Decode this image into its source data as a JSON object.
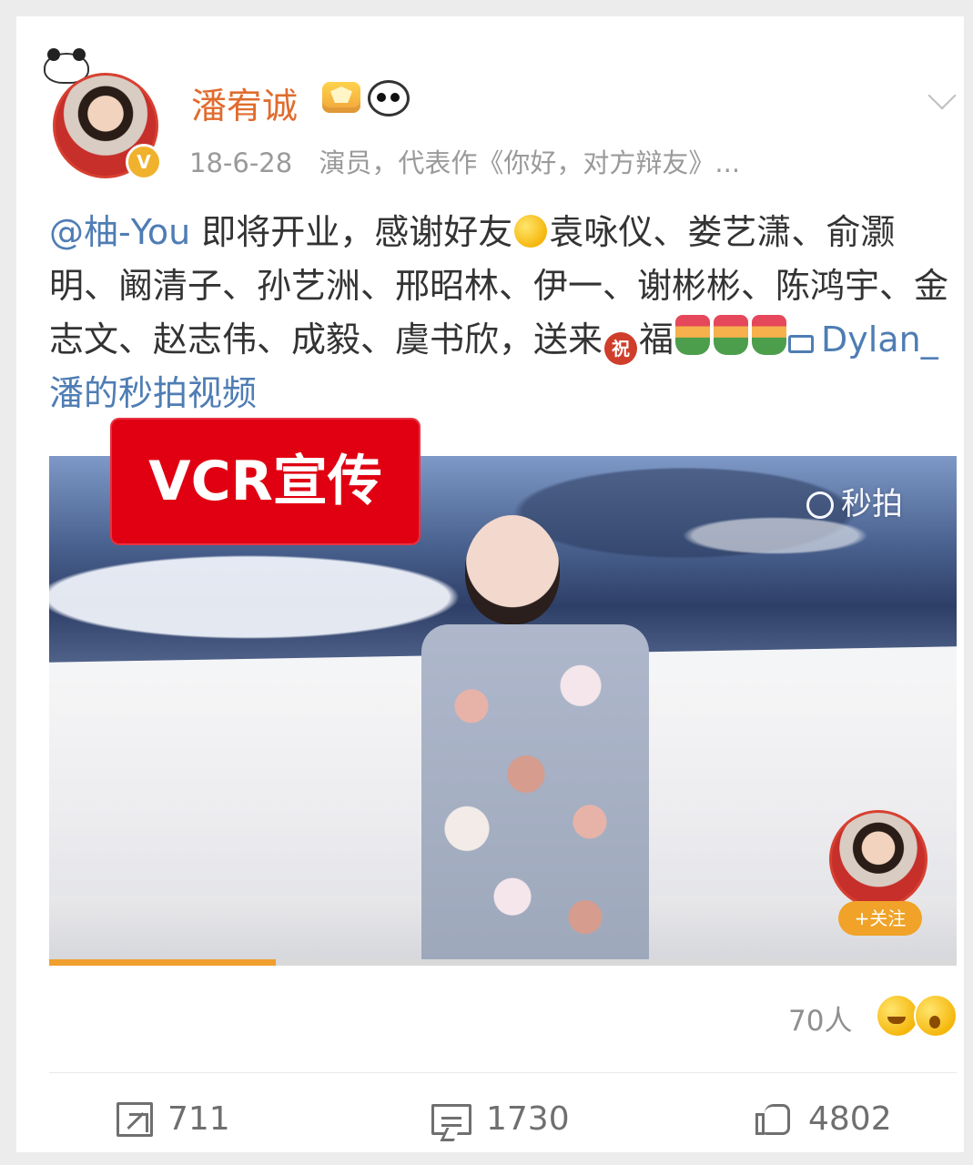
{
  "post": {
    "author": {
      "name": "潘宥诚",
      "verified_label": "V",
      "time": "18-6-28",
      "bio": "演员，代表作《你好，对方辩友》..."
    },
    "text": {
      "mention": "@柚-You",
      "part1": " 即将开业，感谢好友",
      "part2": "袁咏仪、娄艺潇、俞灏明、阚清子、孙艺洲、邢昭林、伊一、谢彬彬、陈鸿宇、金志文、赵志伟、成毅、虞书欣，送来",
      "zhu": "祝",
      "part3": "福",
      "video_link": "Dylan_潘的秒拍视频"
    },
    "overlay": {
      "vcr_badge": "VCR宣传",
      "watermark": "秒拍",
      "follow_label": "+关注",
      "progress": 0.25
    },
    "reactions": {
      "count": "70人"
    },
    "actions": {
      "repost": "711",
      "comment": "1730",
      "like": "4802"
    },
    "icons": {
      "expand": "chevron-down-icon",
      "repost": "share-icon",
      "comment": "comment-icon",
      "like": "thumb-up-icon"
    },
    "colors": {
      "author_name": "#e06c2e",
      "link_blue": "#4f7db4",
      "badge_red": "#e00012",
      "progress_orange": "#ef9f2d"
    }
  }
}
